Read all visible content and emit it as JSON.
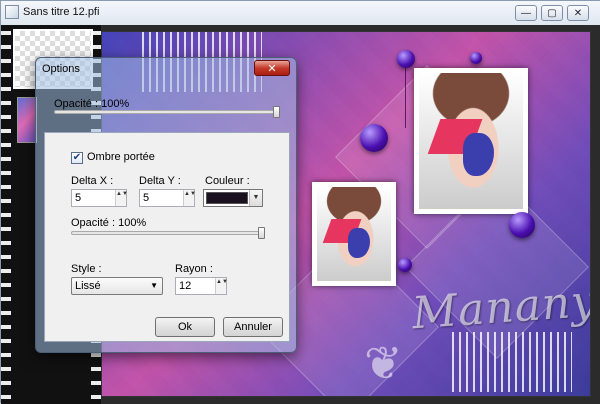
{
  "window": {
    "title": "Sans titre 12.pfi",
    "minimize_glyph": "—",
    "maximize_glyph": "▢",
    "close_glyph": "✕"
  },
  "artwork": {
    "signature": "Manany"
  },
  "dialog": {
    "title": "Options",
    "close_glyph": "✕",
    "opacity_label": "Opacité : 100%",
    "opacity_value": 100,
    "shadow_checkbox_label": "Ombre portée",
    "shadow_checked": true,
    "check_glyph": "✔",
    "delta_x_label": "Delta X :",
    "delta_x_value": "5",
    "delta_y_label": "Delta Y :",
    "delta_y_value": "5",
    "color_label": "Couleur :",
    "shadow_color": "#1a1220",
    "shadow_opacity_label": "Opacité : 100%",
    "shadow_opacity_value": 100,
    "style_label": "Style :",
    "style_value": "Lissé",
    "radius_label": "Rayon :",
    "radius_value": "12",
    "ok_label": "Ok",
    "cancel_label": "Annuler",
    "spin_glyph": "▲▼",
    "dropdown_glyph": "▼"
  },
  "colors": {
    "accent_close": "#c53a2a",
    "artwork_pink": "#e06ab5",
    "artwork_blue": "#4b4fc8"
  }
}
